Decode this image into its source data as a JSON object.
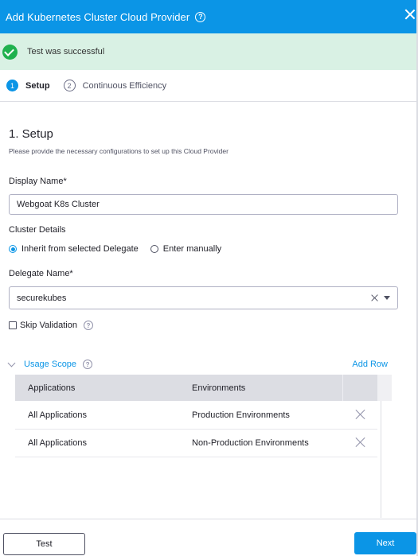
{
  "dialog": {
    "title": "Add Kubernetes Cluster Cloud Provider",
    "help_icon": "help-circle-icon",
    "close_icon": "close-icon"
  },
  "status": {
    "message": "Test was successful",
    "icon": "check-circle-icon",
    "color": "#1fb14e"
  },
  "steps": [
    {
      "number": "1",
      "label": "Setup",
      "active": true
    },
    {
      "number": "2",
      "label": "Continuous Efficiency",
      "active": false
    }
  ],
  "setup": {
    "title": "1. Setup",
    "description": "Please provide the necessary configurations to set up this Cloud Provider",
    "display_name": {
      "label": "Display Name*",
      "value": "Webgoat K8s Cluster"
    },
    "cluster_details": {
      "label": "Cluster Details",
      "options": [
        {
          "label": "Inherit from selected Delegate",
          "selected": true
        },
        {
          "label": "Enter manually",
          "selected": false
        }
      ]
    },
    "delegate_name": {
      "label": "Delegate Name*",
      "value": "securekubes"
    },
    "skip_validation": {
      "label": "Skip Validation",
      "checked": false
    }
  },
  "usage_scope": {
    "label": "Usage Scope",
    "add_row": "Add Row",
    "columns": [
      "Applications",
      "Environments"
    ],
    "rows": [
      {
        "application": "All Applications",
        "environment": "Production Environments"
      },
      {
        "application": "All Applications",
        "environment": "Non-Production Environments"
      }
    ]
  },
  "footer": {
    "test_label": "Test",
    "next_label": "Next"
  },
  "colors": {
    "brand": "#0b95e6",
    "success_bg": "#d9f1e4",
    "table_header": "#dcdde3"
  }
}
